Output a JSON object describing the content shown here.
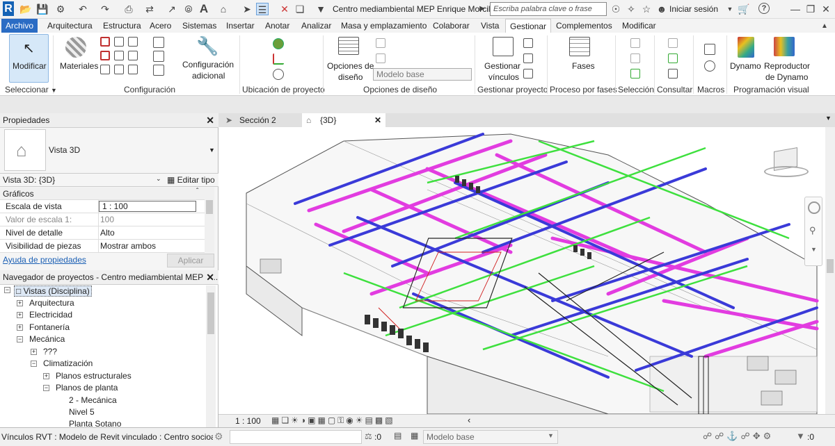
{
  "titlebar": {
    "app_logo": "R",
    "document_title": "Centro mediambiental MEP  Enrique Morcil...",
    "search_placeholder": "Escriba palabra clave o frase",
    "signin": "Iniciar sesión"
  },
  "menu": {
    "tabs": [
      "Archivo",
      "Arquitectura",
      "Estructura",
      "Acero",
      "Sistemas",
      "Insertar",
      "Anotar",
      "Analizar",
      "Masa y emplazamiento",
      "Colaborar",
      "Vista",
      "Gestionar",
      "Complementos",
      "Modificar"
    ],
    "active": "Gestionar"
  },
  "ribbon": {
    "modify": "Modificar",
    "materials": "Materiales",
    "config_add_1": "Configuración",
    "config_add_2": "adicional",
    "design_options_1": "Opciones de",
    "design_options_2": "diseño",
    "design_base": "Modelo base",
    "manage_links_1": "Gestionar",
    "manage_links_2": "vínculos",
    "phases": "Fases",
    "dynamo": "Dynamo",
    "dynamo_player_1": "Reproductor",
    "dynamo_player_2": "de Dynamo",
    "panels": {
      "select": "Seleccionar",
      "settings": "Configuración",
      "location": "Ubicación de proyecto",
      "design_options": "Opciones de diseño",
      "manage_project": "Gestionar proyecto",
      "phasing": "Proceso por fases",
      "selection": "Selección",
      "inquiry": "Consultar",
      "macros": "Macros",
      "visual_programming": "Programación visual"
    }
  },
  "properties": {
    "header": "Propiedades",
    "type_name": "Vista 3D",
    "instance": "Vista 3D: {3D}",
    "edit_type": "Editar tipo",
    "group": "Gráficos",
    "rows": [
      {
        "key": "Escala de vista",
        "value": "1 : 100"
      },
      {
        "key": "Valor de escala    1:",
        "value": "100"
      },
      {
        "key": "Nivel de detalle",
        "value": "Alto"
      },
      {
        "key": "Visibilidad de piezas",
        "value": "Mostrar ambos"
      }
    ],
    "help_link": "Ayuda de propiedades",
    "apply": "Aplicar"
  },
  "browser": {
    "header": "Navegador de proyectos - Centro mediambiental MEP  E...",
    "root": "Vistas (Disciplina)",
    "items": [
      "Arquitectura",
      "Electricidad",
      "Fontanería",
      "Mecánica",
      "???",
      "Climatización",
      "Planos estructurales",
      "Planos de planta",
      "2 - Mecánica",
      "Nivel 5",
      "Planta Sotano"
    ]
  },
  "view_tabs": [
    "Sección 2",
    "{3D}"
  ],
  "view_status": {
    "scale": "1 : 100"
  },
  "status": {
    "text": "Vínculos RVT : Modelo de Revit vinculado : Centro socioambi",
    "count": ":0",
    "model": "Modelo base",
    "filter_count": ":0"
  },
  "colors": {
    "file_tab": "#2b6cc4",
    "pipe_magenta": "#e23ce0",
    "pipe_blue": "#3a3ad8",
    "pipe_green": "#3ee03e"
  }
}
